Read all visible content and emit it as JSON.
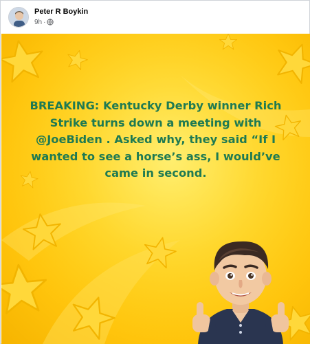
{
  "post": {
    "author": "Peter R Boykin",
    "time": "9h",
    "separator": "·",
    "privacy_icon": "globe-icon"
  },
  "image": {
    "caption_lines": [
      "BREAKING: Kentucky Derby winner Rich",
      "Strike turns down a meeting with",
      "@JoeBiden . Asked why, they said “If I",
      "wanted to see a horse’s ass, I would’ve",
      "came in second."
    ],
    "colors": {
      "background": "#ffcc10",
      "stars": "#ffd83a",
      "caption_text": "#1f7a52"
    },
    "figure": "memoji-thumbs-up"
  }
}
